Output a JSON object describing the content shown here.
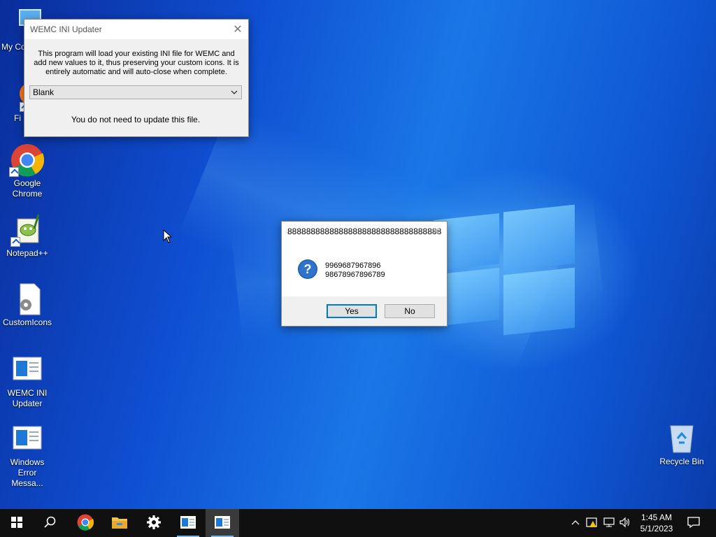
{
  "desktop": {
    "icons": [
      {
        "label": "My Co"
      },
      {
        "label": "Fi"
      },
      {
        "label": "Google Chrome"
      },
      {
        "label": "Notepad++"
      },
      {
        "label": "CustomIcons"
      },
      {
        "label": "WEMC INI Updater"
      },
      {
        "label": "Windows Error Messa..."
      },
      {
        "label": "Recycle Bin"
      }
    ]
  },
  "updater": {
    "title": "WEMC INI Updater",
    "description": "This program will load your existing INI file for WEMC and add new values to it, thus preserving your custom icons. It is entirely automatic and will auto-close when complete.",
    "select_value": "Blank",
    "status": "You do not need to update this file."
  },
  "msgbox": {
    "title": "888888888888888888888888888888888",
    "line1": "9969687967896",
    "line2": "98678967896789",
    "yes_label": "Yes",
    "no_label": "No",
    "icon": "question-icon"
  },
  "taskbar": {
    "items": [
      "start-icon",
      "search-icon",
      "chrome-icon",
      "file-explorer-icon",
      "settings-icon",
      "wemc-app-icon",
      "error-message-app-icon"
    ],
    "clock_time": "1:45 AM",
    "clock_date": "5/1/2023"
  },
  "colors": {
    "accent": "#0078d7",
    "taskbar": "#101010"
  }
}
